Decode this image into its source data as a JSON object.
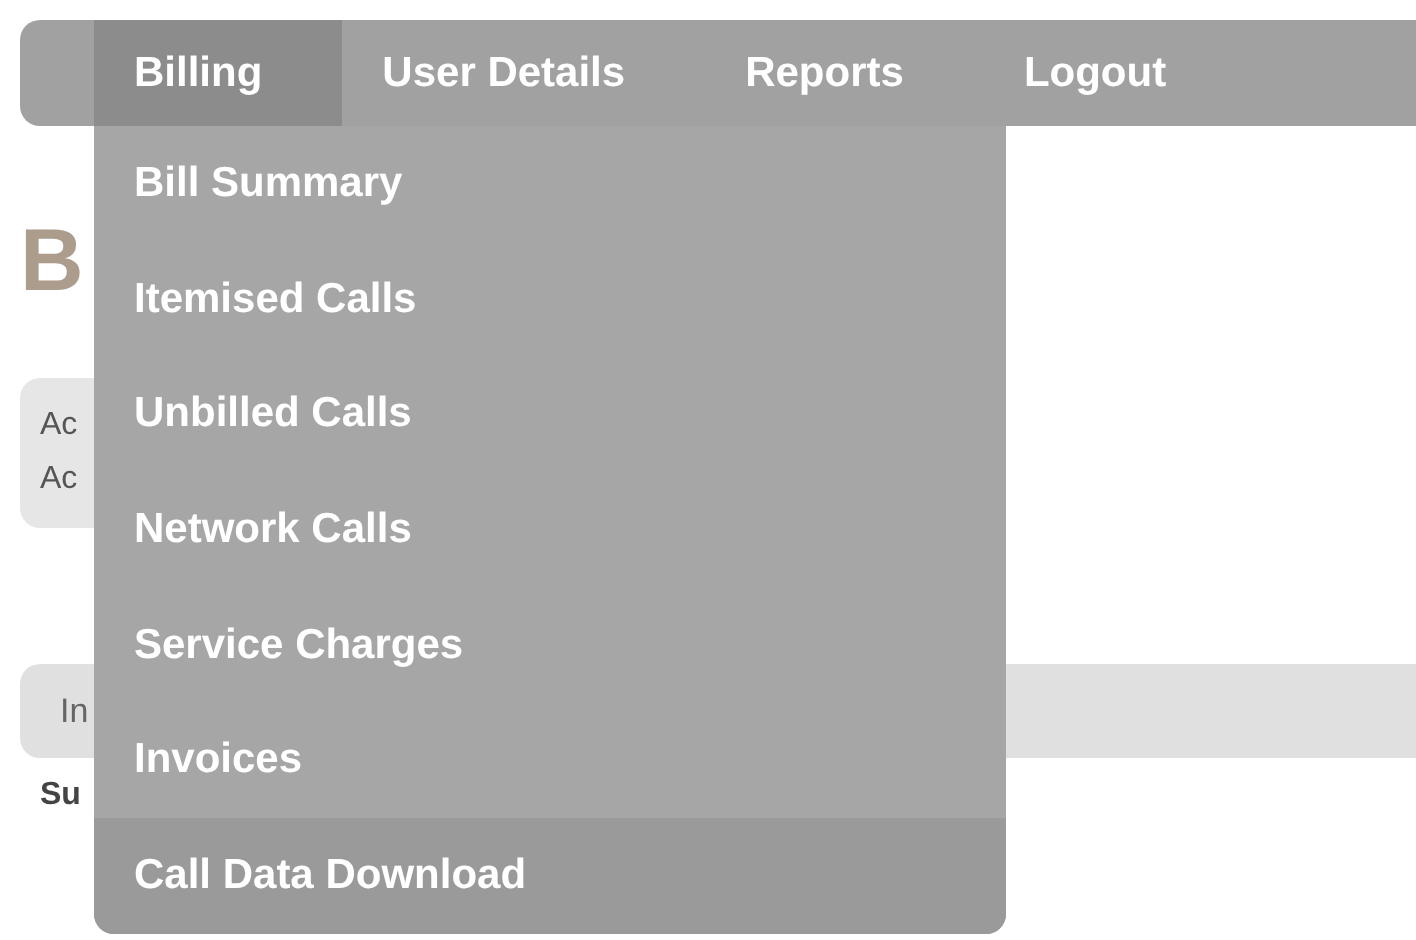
{
  "nav": {
    "tabs": [
      {
        "label": "Billing",
        "selected": true
      },
      {
        "label": "User Details",
        "selected": false
      },
      {
        "label": "Reports",
        "selected": false
      },
      {
        "label": "Logout",
        "selected": false
      }
    ]
  },
  "dropdown": {
    "items": [
      {
        "label": "Bill Summary",
        "selected": false
      },
      {
        "label": "Itemised Calls",
        "selected": false
      },
      {
        "label": "Unbilled Calls",
        "selected": false
      },
      {
        "label": "Network Calls",
        "selected": false
      },
      {
        "label": "Service Charges",
        "selected": false
      },
      {
        "label": "Invoices",
        "selected": false
      },
      {
        "label": "Call Data Download",
        "selected": true
      }
    ]
  },
  "page": {
    "heading": "B",
    "account_lines": [
      "Ac",
      "Ac"
    ],
    "invoice_bar": "In",
    "summary_label": "Su"
  }
}
